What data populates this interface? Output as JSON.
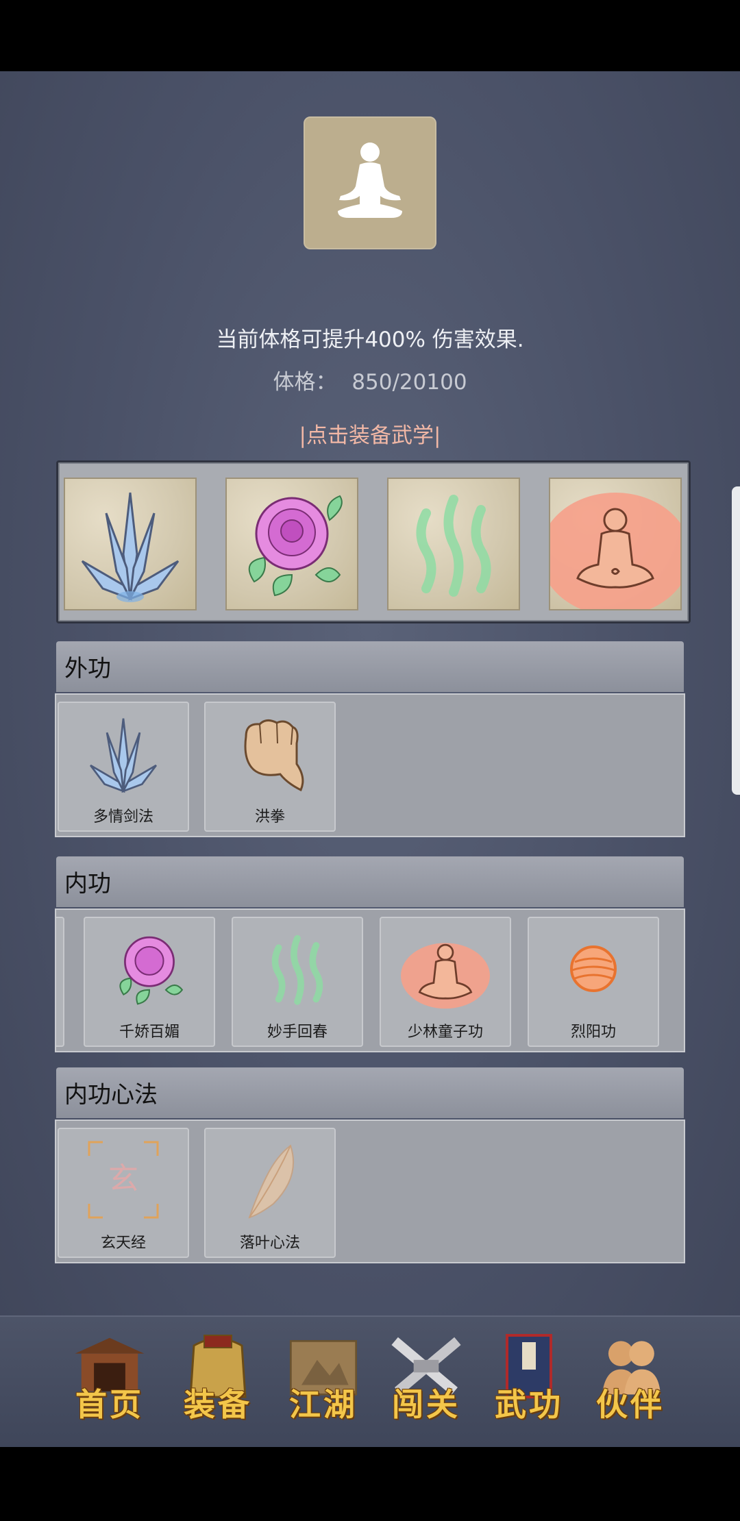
{
  "header": {
    "portrait_icon": "meditation-figure-icon",
    "description": "当前体格可提升400% 伤害效果.",
    "stat_label": "体格：",
    "stat_value": "850/20100",
    "equip_link": "|点击装备武学|"
  },
  "equipped_slots": [
    {
      "icon": "sword-fan-icon"
    },
    {
      "icon": "rose-icon"
    },
    {
      "icon": "green-waves-icon"
    },
    {
      "icon": "meditating-monk-icon"
    }
  ],
  "sections": {
    "external": {
      "title": "外功",
      "items": [
        {
          "label": "多情剑法",
          "icon": "sword-fan-icon"
        },
        {
          "label": "洪拳",
          "icon": "fist-icon"
        }
      ]
    },
    "internal": {
      "title": "内功",
      "items": [
        {
          "label": "千娇百媚",
          "icon": "rose-icon"
        },
        {
          "label": "妙手回春",
          "icon": "green-waves-icon"
        },
        {
          "label": "少林童子功",
          "icon": "meditating-monk-icon"
        },
        {
          "label": "烈阳功",
          "icon": "sun-orb-icon"
        }
      ]
    },
    "heart": {
      "title": "内功心法",
      "items": [
        {
          "label": "玄天经",
          "icon": "xuan-seal-icon"
        },
        {
          "label": "落叶心法",
          "icon": "leaf-icon"
        }
      ]
    }
  },
  "nav": [
    {
      "label": "首页",
      "icon": "temple-icon"
    },
    {
      "label": "装备",
      "icon": "armor-icon"
    },
    {
      "label": "江湖",
      "icon": "scroll-map-icon"
    },
    {
      "label": "闯关",
      "icon": "crossed-swords-icon"
    },
    {
      "label": "武功",
      "icon": "martial-book-icon"
    },
    {
      "label": "伙伴",
      "icon": "companions-icon"
    }
  ]
}
